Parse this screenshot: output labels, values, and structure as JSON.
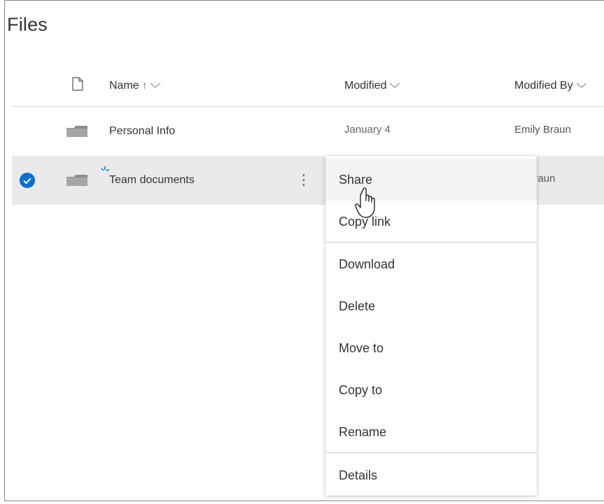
{
  "page": {
    "title": "Files"
  },
  "columns": {
    "type_icon": "document-icon",
    "name": "Name",
    "name_sort": "↑",
    "modified": "Modified",
    "modified_by": "Modified By"
  },
  "rows": [
    {
      "name": "Personal Info",
      "modified": "January 4",
      "modified_by": "Emily Braun",
      "selected": false,
      "icon": "folder-icon"
    },
    {
      "name": "Team documents",
      "modified": "",
      "modified_by": "ily Braun",
      "selected": true,
      "icon": "folder-icon",
      "more": "⋮"
    }
  ],
  "context_menu": {
    "items": [
      {
        "label": "Share"
      },
      {
        "label": "Copy link"
      },
      {
        "label": "Download"
      },
      {
        "label": "Delete"
      },
      {
        "label": "Move to"
      },
      {
        "label": "Copy to"
      },
      {
        "label": "Rename"
      },
      {
        "label": "Details"
      }
    ]
  },
  "colors": {
    "accent": "#0a6ecf",
    "selected_row": "#eaeaea",
    "divider": "#c8c8c8"
  }
}
